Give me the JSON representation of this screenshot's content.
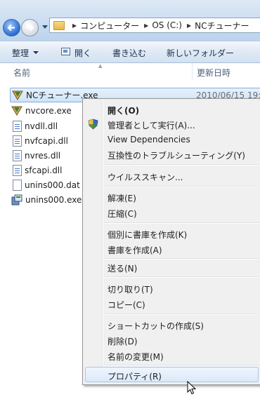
{
  "address": {
    "breadcrumbs": [
      "コンピューター",
      "OS (C:)",
      "NCチューナー"
    ]
  },
  "toolbar": {
    "organize": "整理",
    "open": "開く",
    "burn": "書き込む",
    "new_folder": "新しいフォルダー"
  },
  "columns": {
    "name": "名前",
    "date_modified": "更新日時"
  },
  "files": [
    {
      "name": "NCチューナー.exe",
      "date": "2010/06/15 19:",
      "icon": "exe-tuner-icon",
      "selected": true
    },
    {
      "name": "nvcore.exe",
      "icon": "exe-tuner-icon"
    },
    {
      "name": "nvdll.dll",
      "icon": "dll-icon"
    },
    {
      "name": "nvfcapi.dll",
      "icon": "dll-icon"
    },
    {
      "name": "nvres.dll",
      "icon": "dll-icon"
    },
    {
      "name": "sfcapi.dll",
      "icon": "dll-icon"
    },
    {
      "name": "unins000.dat",
      "icon": "dat-file-icon"
    },
    {
      "name": "unins000.exe",
      "icon": "installer-icon"
    }
  ],
  "context_menu": {
    "open": "開く(O)",
    "run_as_admin": "管理者として実行(A)...",
    "view_dependencies": "View Dependencies",
    "compat_troubleshoot": "互換性のトラブルシューティング(Y)",
    "virus_scan": "ウイルススキャン...",
    "extract": "解凍(E)",
    "compress": "圧縮(C)",
    "create_each_archive": "個別に書庫を作成(K)",
    "create_archive": "書庫を作成(A)",
    "send_to": "送る(N)",
    "cut": "切り取り(T)",
    "copy": "コピー(C)",
    "create_shortcut": "ショートカットの作成(S)",
    "delete": "削除(D)",
    "rename": "名前の変更(M)",
    "properties": "プロパティ(R)"
  },
  "colors": {
    "selection": "#cfe4f9",
    "menu_bg": "#f0f0f0",
    "toolbar_bg": "#dfe9f5"
  }
}
